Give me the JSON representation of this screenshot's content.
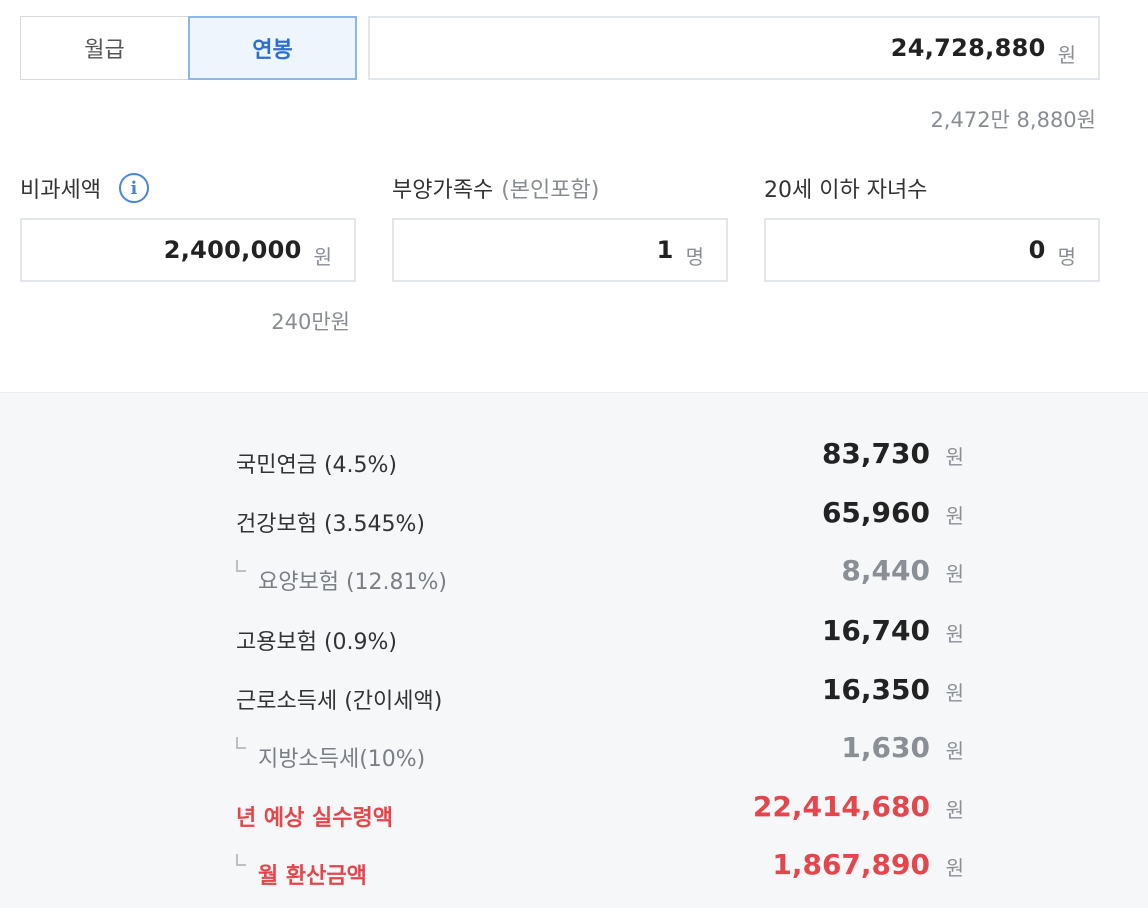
{
  "tabs": {
    "monthly": "월급",
    "annual": "연봉",
    "active": "annual"
  },
  "salary": {
    "value": "24,728,880",
    "unit": "원",
    "readable": "2,472만 8,880원"
  },
  "nontax": {
    "label": "비과세액",
    "info_icon": "info-icon",
    "value": "2,400,000",
    "unit": "원",
    "readable": "240만원"
  },
  "dependents": {
    "label": "부양가족수",
    "label_sub": "(본인포함)",
    "value": "1",
    "unit": "명"
  },
  "children": {
    "label": "20세 이하 자녀수",
    "value": "0",
    "unit": "명"
  },
  "results": [
    {
      "name": "국민연금 (4.5%)",
      "amount": "83,730",
      "unit": "원",
      "kind": "main"
    },
    {
      "name": "건강보험 (3.545%)",
      "amount": "65,960",
      "unit": "원",
      "kind": "main"
    },
    {
      "name": "요양보험 (12.81%)",
      "amount": "8,440",
      "unit": "원",
      "kind": "sub"
    },
    {
      "name": "고용보험 (0.9%)",
      "amount": "16,740",
      "unit": "원",
      "kind": "main"
    },
    {
      "name": "근로소득세 (간이세액)",
      "amount": "16,350",
      "unit": "원",
      "kind": "main"
    },
    {
      "name": "지방소득세(10%)",
      "amount": "1,630",
      "unit": "원",
      "kind": "sub"
    },
    {
      "name": "년 예상 실수령액",
      "amount": "22,414,680",
      "unit": "원",
      "kind": "total"
    },
    {
      "name": "월 환산금액",
      "amount": "1,867,890",
      "unit": "원",
      "kind": "total-sub"
    }
  ],
  "colors": {
    "accent": "#2f6fce",
    "highlight_red": "#e4464b",
    "result_bg": "#f6f7f9"
  }
}
